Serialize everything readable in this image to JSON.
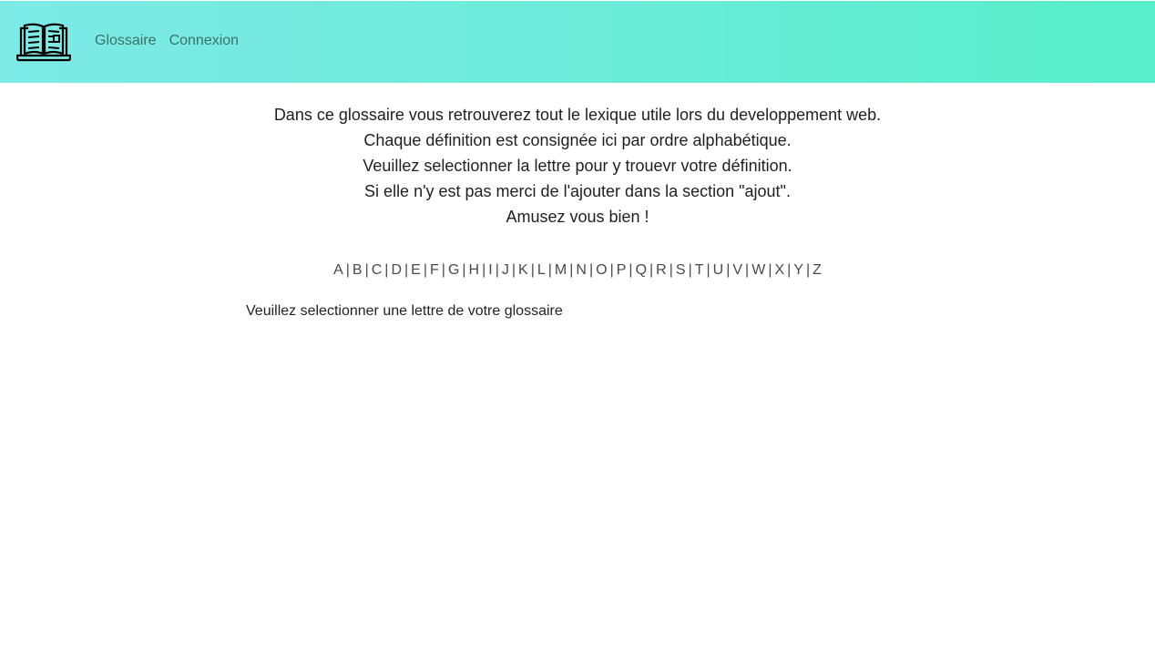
{
  "nav": {
    "links": [
      "Glossaire",
      "Connexion"
    ]
  },
  "intro": {
    "lines": [
      "Dans ce glossaire vous retrouverez tout le lexique utile lors du developpement web.",
      "Chaque définition est consignée ici par ordre alphabétique.",
      "Veuillez selectionner la lettre pour y trouevr votre définition.",
      "Si elle n'y est pas merci de l'ajouter dans la section \"ajout\".",
      "Amusez vous bien !"
    ]
  },
  "alphabet": [
    "A",
    "B",
    "C",
    "D",
    "E",
    "F",
    "G",
    "H",
    "I",
    "J",
    "K",
    "L",
    "M",
    "N",
    "O",
    "P",
    "Q",
    "R",
    "S",
    "T",
    "U",
    "V",
    "W",
    "X",
    "Y",
    "Z"
  ],
  "alphabet_separator": "|",
  "prompt": "Veuillez selectionner une lettre de votre glossaire",
  "colors": {
    "header_gradient_start": "#7deae6",
    "header_gradient_end": "#57eec9",
    "nav_link": "#3d6f6a"
  },
  "icons": {
    "logo": "open-book-laptop-icon"
  }
}
